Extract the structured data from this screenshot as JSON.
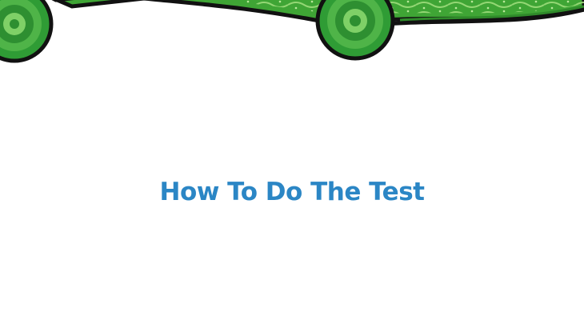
{
  "slide": {
    "title": "How To Do The Test"
  },
  "decoration": {
    "band_name": "dot-art-band",
    "icons": [
      "concentric-circle-left",
      "concentric-circle-center"
    ]
  },
  "colors": {
    "title": "#2b86c5",
    "band_fill": "#3fa535",
    "band_pattern": "#8fd36f",
    "outline": "#111111",
    "background": "#ffffff"
  }
}
